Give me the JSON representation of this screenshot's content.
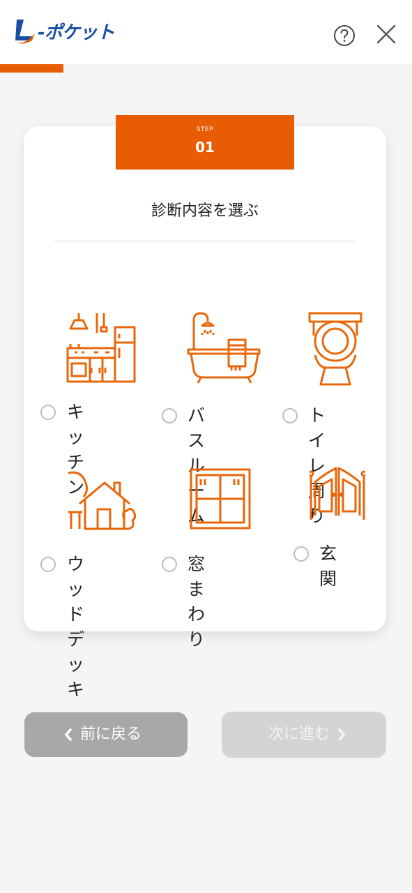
{
  "header": {
    "logo_text": "-ポケット",
    "help_icon": "help-circle-icon",
    "close_icon": "close-icon"
  },
  "progress": {
    "value_percent": 15.4
  },
  "step": {
    "label": "STEP",
    "number": "01"
  },
  "card": {
    "title": "診断内容を選ぶ",
    "options": [
      {
        "id": "kitchen",
        "line1": "キッチ",
        "line2": "ン",
        "icon": "kitchen-icon",
        "selected": false
      },
      {
        "id": "bathroom",
        "line1": "バスルー",
        "line2": "ム",
        "icon": "bathtub-icon",
        "selected": false
      },
      {
        "id": "toilet",
        "line1": "トイレ",
        "line2": "周り",
        "icon": "toilet-icon",
        "selected": false
      },
      {
        "id": "wood-deck",
        "line1": "ウッド",
        "line2": "デッキ",
        "icon": "house-icon",
        "selected": false
      },
      {
        "id": "window",
        "line1": "窓まわ",
        "line2": "り",
        "icon": "window-icon",
        "selected": false
      },
      {
        "id": "entrance",
        "line1": "玄関",
        "line2": "",
        "icon": "door-icon",
        "selected": false
      }
    ]
  },
  "nav": {
    "back_label": "前に戻る",
    "next_label": "次に進む"
  },
  "colors": {
    "accent": "#e85d04",
    "brand": "#1a4fa3",
    "back_button": "#a8a8a8",
    "next_button_disabled": "#d4d4d4"
  }
}
